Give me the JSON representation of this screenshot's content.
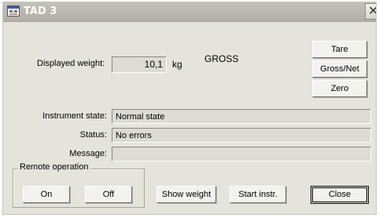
{
  "window": {
    "title": "TAD 3",
    "close_glyph": "✕",
    "app_icon": "terminal-window-icon"
  },
  "weight": {
    "label": "Displayed weight:",
    "value": "10,1",
    "unit": "kg",
    "mode": "GROSS"
  },
  "side_buttons": {
    "tare": "Tare",
    "gross_net": "Gross/Net",
    "zero": "Zero"
  },
  "info": {
    "instrument_state_label": "Instrument state:",
    "instrument_state_value": "Normal state",
    "status_label": "Status:",
    "status_value": "No errors",
    "message_label": "Message:",
    "message_value": ""
  },
  "remote": {
    "legend": "Remote operation",
    "on": "On",
    "off": "Off"
  },
  "bottom_buttons": {
    "show_weight": "Show weight",
    "start_instr": "Start instr.",
    "close": "Close"
  }
}
